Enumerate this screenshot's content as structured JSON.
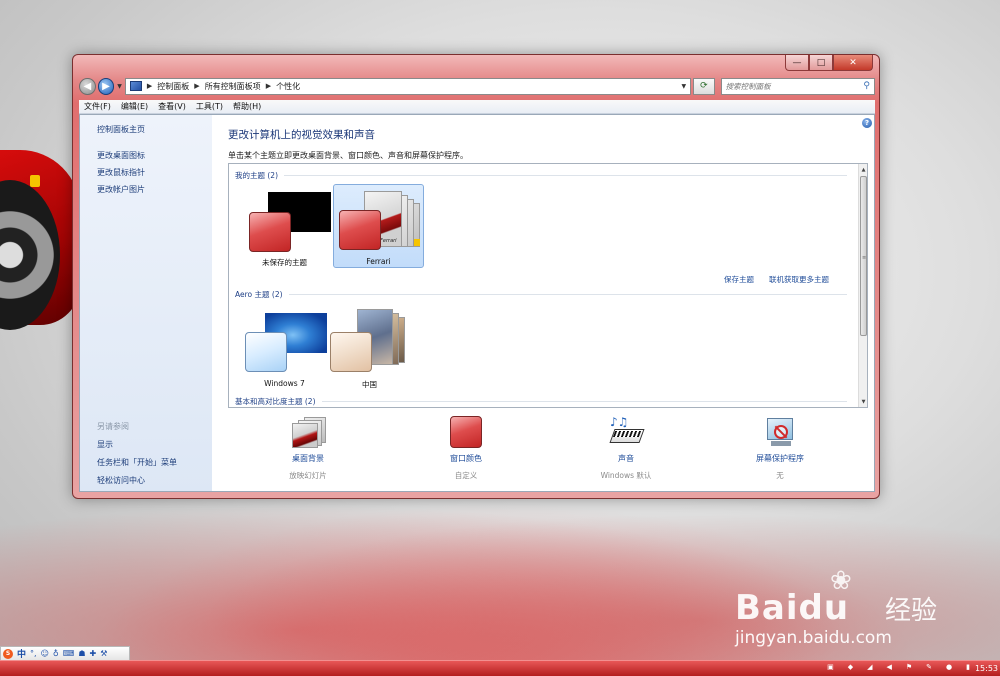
{
  "window": {
    "address": {
      "crumbs": [
        "控制面板",
        "所有控制面板项",
        "个性化"
      ]
    },
    "search": {
      "placeholder": "搜索控制面板"
    },
    "caption": {
      "minimize": "—",
      "maximize": "□",
      "close": "✕"
    }
  },
  "menu": {
    "items": [
      "文件(F)",
      "编辑(E)",
      "查看(V)",
      "工具(T)",
      "帮助(H)"
    ]
  },
  "sidebar": {
    "home": "控制面板主页",
    "links": [
      "更改桌面图标",
      "更改鼠标指针",
      "更改帐户图片"
    ],
    "see_also_label": "另请参阅",
    "see_also": [
      "显示",
      "任务栏和「开始」菜单",
      "轻松访问中心"
    ]
  },
  "main": {
    "title": "更改计算机上的视觉效果和声音",
    "subtitle": "单击某个主题立即更改桌面背景、窗口颜色、声音和屏幕保护程序。",
    "groups": [
      {
        "header": "我的主题 (2)",
        "themes": [
          {
            "name": "未保存的主题"
          },
          {
            "name": "Ferrari",
            "selected": true,
            "brand": "Ferrari"
          }
        ]
      },
      {
        "header": "Aero 主题 (2)",
        "themes": [
          {
            "name": "Windows 7"
          },
          {
            "name": "中国"
          }
        ]
      },
      {
        "header": "基本和高对比度主题 (2)",
        "themes": []
      }
    ],
    "links": {
      "save_theme": "保存主题",
      "get_more": "联机获取更多主题"
    },
    "bottom": [
      {
        "label": "桌面背景",
        "value": "放映幻灯片"
      },
      {
        "label": "窗口颜色",
        "value": "自定义"
      },
      {
        "label": "声音",
        "value": "Windows 默认"
      },
      {
        "label": "屏幕保护程序",
        "value": "无"
      }
    ]
  },
  "taskbar": {
    "ime_text": "中",
    "clock": "15:53"
  },
  "watermark": {
    "brand": "Bai",
    "brand_suffix": "du",
    "cn": "经验",
    "url": "jingyan.baidu.com"
  },
  "colors": {
    "window_frame": "#e06e6e",
    "link": "#1e4b98",
    "title": "#1b3778",
    "selection": "#c2dcfa"
  }
}
